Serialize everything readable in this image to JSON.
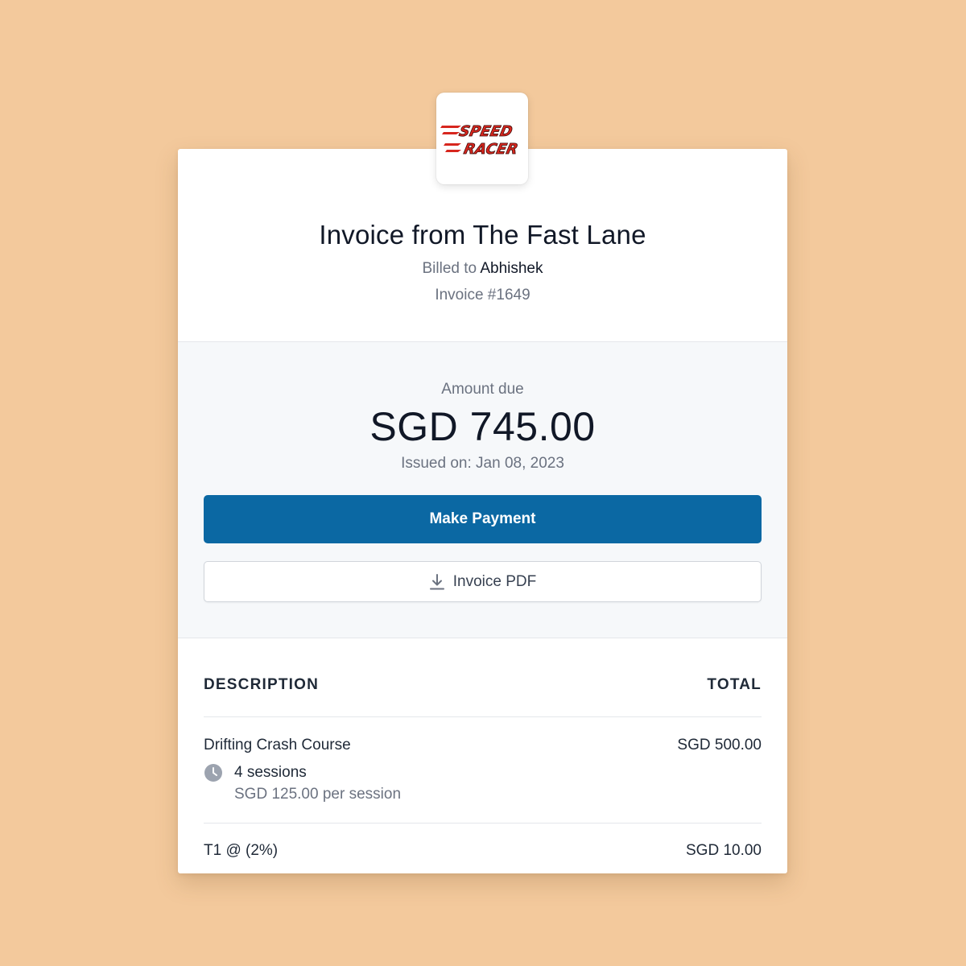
{
  "brand": {
    "logo_text_top": "SPEED",
    "logo_text_bottom": "RACER",
    "logo_color": "#d7261e"
  },
  "header": {
    "title": "Invoice from The Fast Lane",
    "billed_prefix": "Billed to",
    "billed_name": "Abhishek",
    "invoice_number": "Invoice #1649"
  },
  "summary": {
    "amount_label": "Amount due",
    "amount": "SGD 745.00",
    "issued": "Issued on: Jan 08, 2023",
    "pay_button": "Make Payment",
    "pdf_button": "Invoice PDF"
  },
  "items": {
    "col_description": "DESCRIPTION",
    "col_total": "TOTAL",
    "lines": [
      {
        "description": "Drifting Crash Course",
        "total": "SGD 500.00",
        "quantity": "4 sessions",
        "unit_price": "SGD 125.00 per session",
        "icon": "clock-icon"
      },
      {
        "description": "T1 @ (2%)",
        "total": "SGD 10.00"
      }
    ]
  },
  "colors": {
    "background": "#f3c99c",
    "primary_button": "#0b68a3",
    "summary_background": "#f6f8fa"
  }
}
